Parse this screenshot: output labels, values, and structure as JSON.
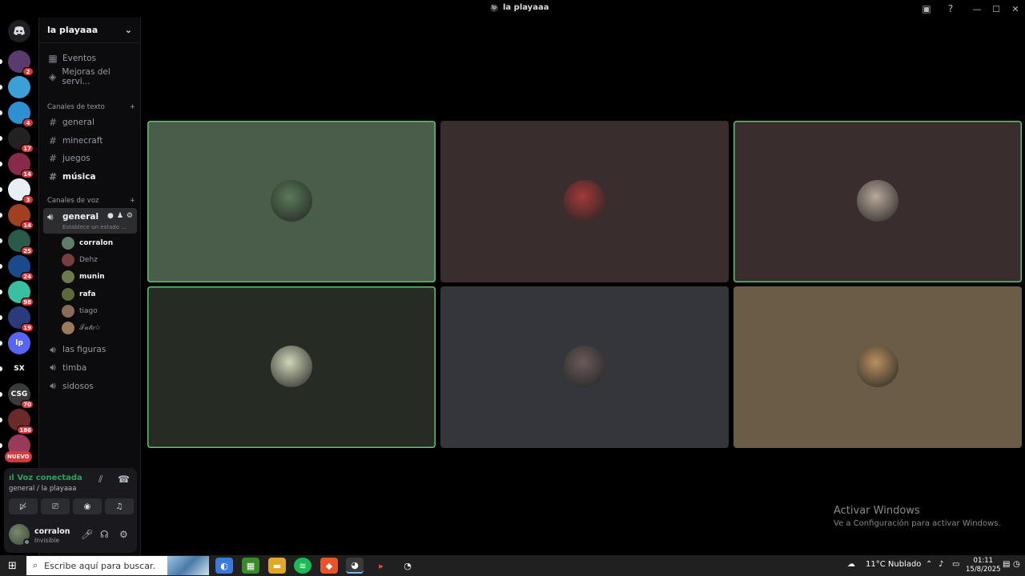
{
  "window": {
    "title": "la playaaa"
  },
  "server": {
    "name": "la playaaa"
  },
  "nav": {
    "events": "Eventos",
    "boosts": "Mejoras del servi..."
  },
  "text_category": "Canales de texto",
  "text_channels": [
    "general",
    "minecraft",
    "juegos",
    "música"
  ],
  "voice_category": "Canales de voz",
  "voice_general": {
    "name": "general",
    "status": "Establece un estado ..."
  },
  "voice_members": [
    {
      "name": "corralon",
      "color": "#5f7d6a"
    },
    {
      "name": "Dehz",
      "color": "#7a3d3d"
    },
    {
      "name": "munin",
      "color": "#6b7a4e"
    },
    {
      "name": "rafa",
      "color": "#5a6a3a"
    },
    {
      "name": "tiago",
      "color": "#8a6a5a"
    },
    {
      "name": "𝒯𝒶𝓉𝑜☆",
      "color": "#9a7a5a"
    }
  ],
  "other_voice_channels": [
    "las figuras",
    "timba",
    "sidosos"
  ],
  "guilds": [
    {
      "badge": "2",
      "color": "#5b3a6e"
    },
    {
      "badge": "",
      "color": "#3ba0d8"
    },
    {
      "badge": "4",
      "color": "#2f8fd0"
    },
    {
      "badge": "17",
      "color": "#222222"
    },
    {
      "badge": "14",
      "color": "#8a2a4a"
    },
    {
      "badge": "3",
      "color": "#e8eef5"
    },
    {
      "badge": "14",
      "color": "#a0401e"
    },
    {
      "badge": "25",
      "color": "#2a5a4a"
    },
    {
      "badge": "24",
      "color": "#1a4a8a"
    },
    {
      "badge": "98",
      "color": "#3ac0a0"
    },
    {
      "badge": "19",
      "color": "#2a3a7a"
    },
    {
      "badge": "",
      "color": "#5865f2",
      "label": "lp"
    },
    {
      "badge": "",
      "color": "#000000",
      "label": "SX"
    },
    {
      "badge": "70",
      "color": "#3a3a3a",
      "label": "CSG"
    },
    {
      "badge": "186",
      "color": "#6a2a2a"
    },
    {
      "badge": "",
      "color": "#9a3a5a"
    }
  ],
  "nuevo_label": "NUEVO",
  "voice_panel": {
    "title": "Voz conectada",
    "subtitle": "general / la playaaa"
  },
  "user": {
    "name": "corralon",
    "status": "Invisible"
  },
  "tiles": [
    {
      "color": "#4a5d4a",
      "speaking": true,
      "avatar": "#5a7a5a"
    },
    {
      "color": "#3a2d2d",
      "speaking": false,
      "avatar": "#a03a3a"
    },
    {
      "color": "#3a2d2d",
      "speaking": true,
      "avatar": "#b8a89a"
    },
    {
      "color": "#262b24",
      "speaking": true,
      "avatar": "#cfd6b8"
    },
    {
      "color": "#35363b",
      "speaking": false,
      "avatar": "#6a5a5a"
    },
    {
      "color": "#6b5c45",
      "speaking": false,
      "avatar": "#b89060"
    }
  ],
  "watermark": {
    "line1": "Activar Windows",
    "line2": "Ve a Configuración para activar Windows."
  },
  "taskbar": {
    "search_placeholder": "Escribe aquí para buscar.",
    "weather": "11°C  Nublado",
    "time": "01:11",
    "date": "15/8/2025"
  }
}
